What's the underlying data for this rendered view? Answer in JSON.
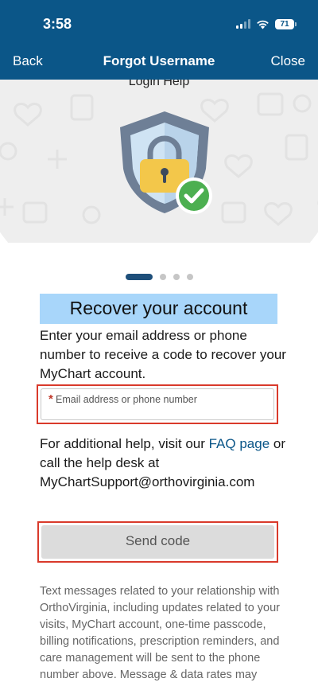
{
  "status_bar": {
    "time": "3:58",
    "battery": "71"
  },
  "nav": {
    "back_label": "Back",
    "title": "Forgot Username",
    "close_label": "Close"
  },
  "hero": {
    "caption": "Login Help"
  },
  "pager": {
    "total": 4,
    "active_index": 0
  },
  "form": {
    "heading": "Recover your account",
    "intro": "Enter your email address or phone number to receive a code to recover your MyChart account.",
    "required_marker": "*",
    "field_label": "Email address or phone number",
    "field_value": ""
  },
  "help": {
    "text_before": "For additional help, visit our ",
    "link_label": "FAQ page",
    "text_after": " or call the help desk at MyChartSupport@orthovirginia.com"
  },
  "send_button_label": "Send code",
  "disclaimer": "Text messages related to your relationship with OrthoVirginia, including updates related to your visits, MyChart account, one-time passcode, billing notifications, prescription reminders, and care management will be sent to the phone number above. Message & data rates may",
  "colors": {
    "header": "#0b5688",
    "heading_highlight": "#a8d6fa",
    "outline": "#d93a2b",
    "check": "#4caf50",
    "lock": "#f3c74a"
  },
  "icons": [
    "signal-icon",
    "wifi-icon",
    "battery-icon",
    "shield-icon",
    "lock-icon",
    "checkmark-icon"
  ]
}
